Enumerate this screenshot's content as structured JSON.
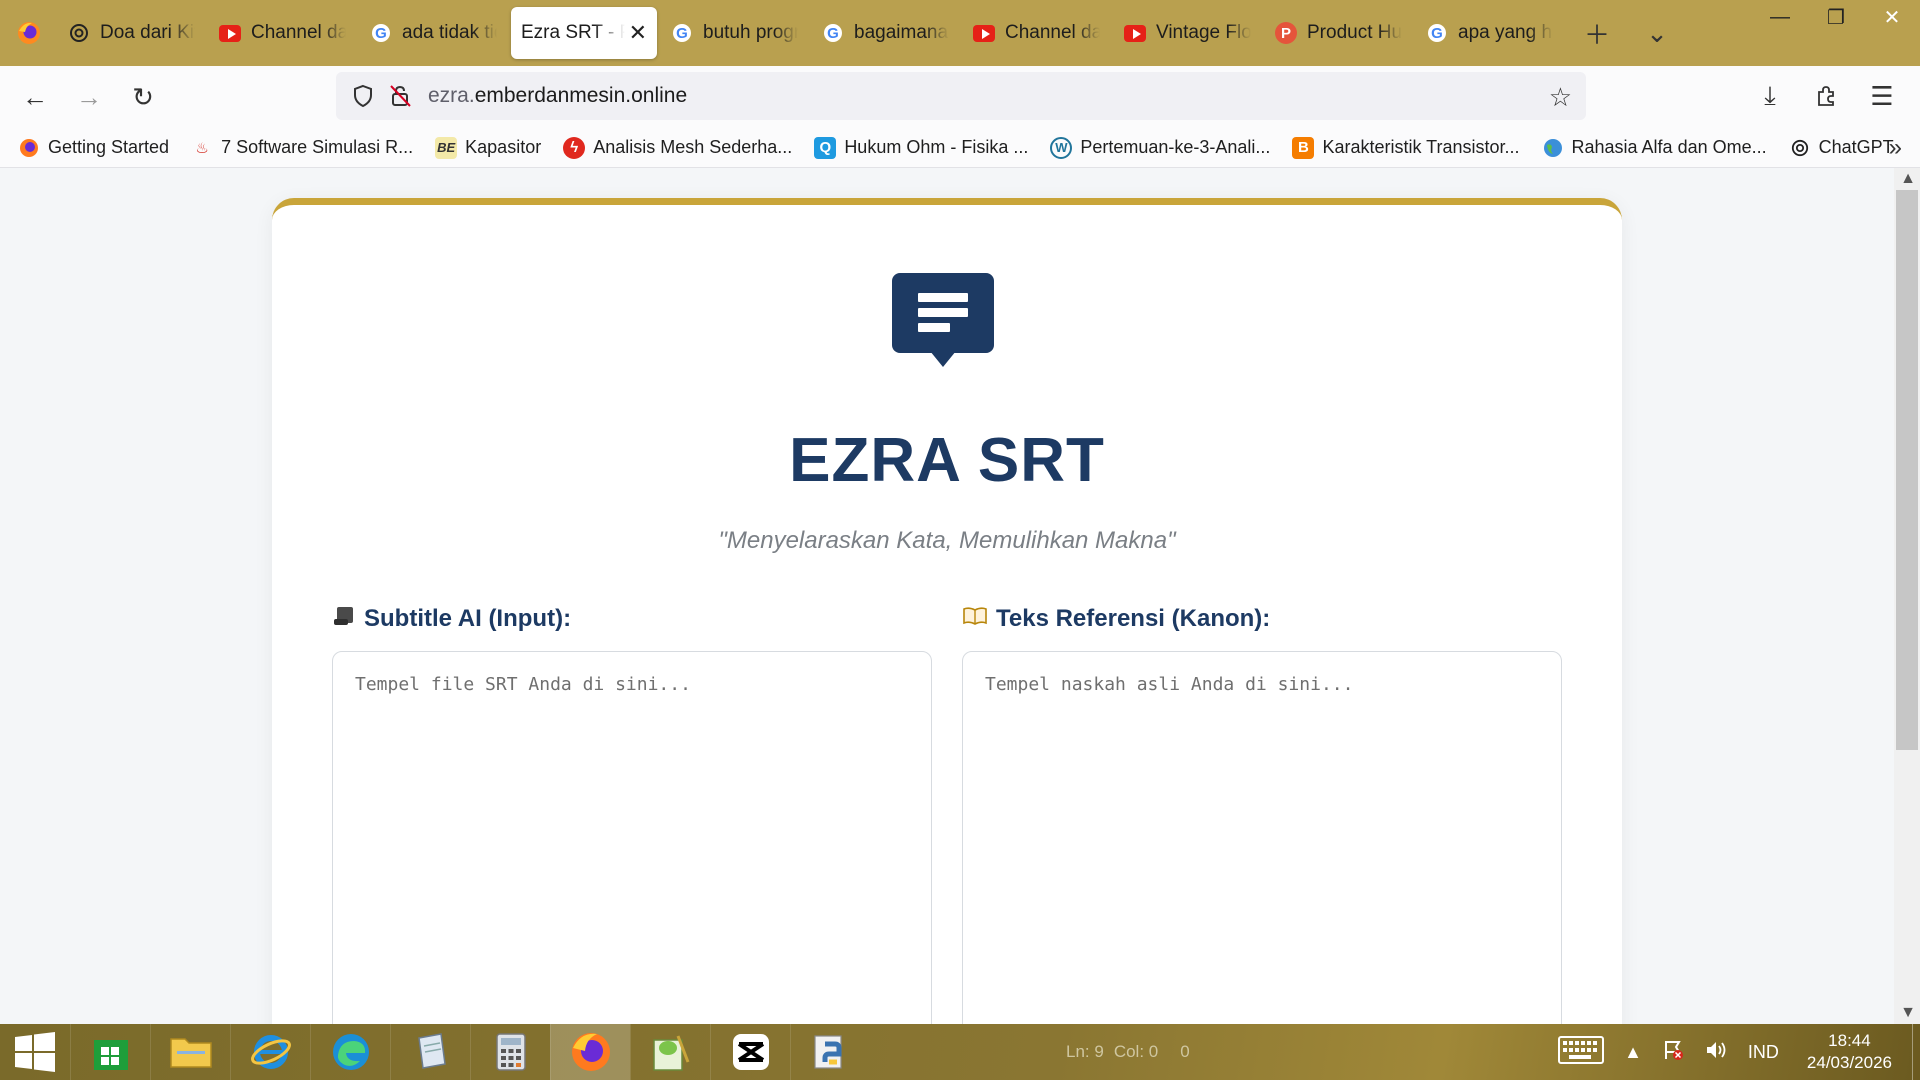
{
  "tabs": [
    {
      "label": "Doa dari Kitab",
      "icon": "chatgpt-icon",
      "active": false
    },
    {
      "label": "Channel dari",
      "icon": "youtube-icon",
      "active": false
    },
    {
      "label": "ada tidak tidak",
      "icon": "google-icon",
      "active": false
    },
    {
      "label": "Ezra SRT - Penyelaras",
      "icon": "none",
      "active": true
    },
    {
      "label": "butuh program",
      "icon": "google-icon",
      "active": false
    },
    {
      "label": "bagaimana cara",
      "icon": "google-icon",
      "active": false
    },
    {
      "label": "Channel dari",
      "icon": "youtube-icon",
      "active": false
    },
    {
      "label": "Vintage Flower",
      "icon": "youtube-icon",
      "active": false
    },
    {
      "label": "Product Hunt",
      "icon": "producthunt-icon",
      "active": false
    },
    {
      "label": "apa yang harus",
      "icon": "google-icon",
      "active": false
    }
  ],
  "url": {
    "prefix": "ezra.",
    "domain": "emberdanmesin.online"
  },
  "bookmarks": [
    {
      "label": "Getting Started",
      "icon": "firefox-icon"
    },
    {
      "label": "7 Software Simulasi R...",
      "icon": "flame-icon"
    },
    {
      "label": "Kapasitor",
      "icon": "be-icon"
    },
    {
      "label": "Analisis Mesh Sederha...",
      "icon": "bolt-icon"
    },
    {
      "label": "Hukum Ohm - Fisika ...",
      "icon": "q-icon"
    },
    {
      "label": "Pertemuan-ke-3-Anali...",
      "icon": "wordpress-icon"
    },
    {
      "label": "Karakteristik Transistor...",
      "icon": "blogger-icon"
    },
    {
      "label": "Rahasia Alfa dan Ome...",
      "icon": "globe-icon"
    },
    {
      "label": "ChatGPT",
      "icon": "chatgpt-icon"
    }
  ],
  "page": {
    "title": "EZRA SRT",
    "tagline": "\"Menyelaraskan Kata, Memulihkan Makna\"",
    "input_label": "Subtitle AI (Input):",
    "input_placeholder": "Tempel file SRT Anda di sini...",
    "reference_label": "Teks Referensi (Kanon):",
    "reference_placeholder": "Tempel naskah asli Anda di sini..."
  },
  "taskbar": {
    "status_line": "Ln: 9",
    "status_col": "Col: 0",
    "status_sel": "0",
    "language": "IND",
    "time": "18:44",
    "date": "24/03/2026"
  },
  "colors": {
    "accent": "#c9a53a",
    "brand": "#1d3a63",
    "tabbar": "#b9a04f"
  }
}
